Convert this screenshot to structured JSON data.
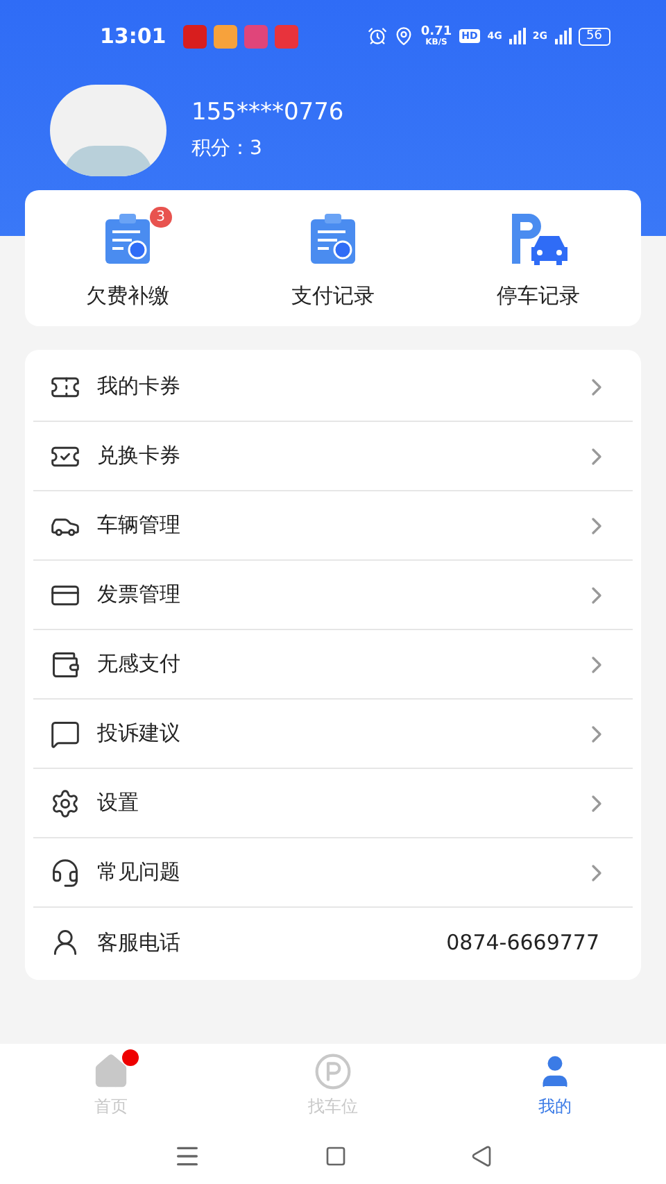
{
  "status_bar": {
    "time": "13:01",
    "speed": "0.71",
    "speed_unit": "KB/S",
    "hd": "HD",
    "network_1": "4G",
    "network_2": "2G",
    "battery": "56"
  },
  "profile": {
    "phone": "155****0776",
    "points": "积分：3"
  },
  "quick_actions": [
    {
      "label": "欠费补缴",
      "badge": "3"
    },
    {
      "label": "支付记录"
    },
    {
      "label": "停车记录"
    }
  ],
  "menu": [
    {
      "kind": "link",
      "label": "我的卡券"
    },
    {
      "kind": "link",
      "label": "兑换卡券"
    },
    {
      "kind": "link",
      "label": "车辆管理"
    },
    {
      "kind": "link",
      "label": "发票管理"
    },
    {
      "kind": "link",
      "label": "无感支付"
    },
    {
      "kind": "link",
      "label": "投诉建议"
    },
    {
      "kind": "link",
      "label": "设置"
    },
    {
      "kind": "link",
      "label": "常见问题"
    },
    {
      "kind": "phone",
      "label": "客服电话",
      "value": "0874-6669777"
    }
  ],
  "tabs": [
    {
      "label": "首页",
      "selected": false,
      "dot": true
    },
    {
      "label": "找车位",
      "selected": false,
      "dot": false
    },
    {
      "label": "我的",
      "selected": true,
      "dot": false
    }
  ]
}
